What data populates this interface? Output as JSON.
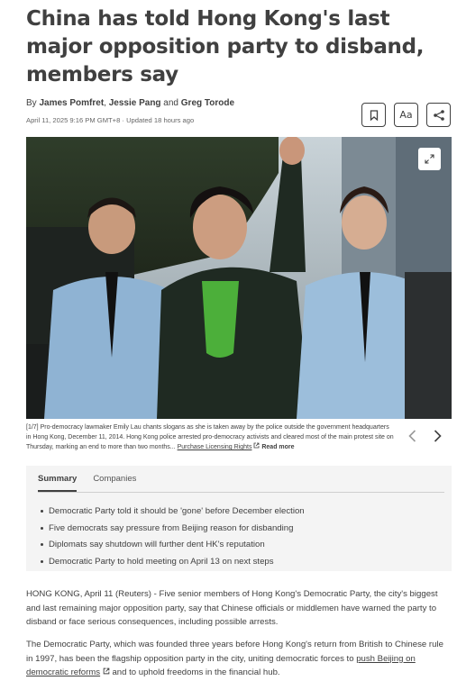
{
  "article": {
    "headline": "China has told Hong Kong's last major opposition party to disband, members say",
    "byline_prefix": "By ",
    "authors": [
      "James Pomfret",
      "Jessie Pang",
      "Greg Torode"
    ],
    "byline_sep1": ", ",
    "byline_sep2": " and ",
    "dateline": "April 11, 2025 9:16 PM GMT+8 · Updated 18 hours ago",
    "text_size_label": "Aa"
  },
  "photo": {
    "caption_counter": "[1/7]",
    "caption_text": " Pro-democracy lawmaker Emily Lau chants slogans as she is taken away by the police outside the government headquarters in Hong Kong, December 11, 2014. Hong Kong police arrested pro-democracy activists and cleared most of the main protest site on Thursday, marking an end to more than two months... ",
    "licensing_link": "Purchase Licensing Rights",
    "read_more": "Read more"
  },
  "summary": {
    "tabs": [
      "Summary",
      "Companies"
    ],
    "items": [
      "Democratic Party told it should be 'gone' before December election",
      "Five democrats say pressure from Beijing reason for disbanding",
      "Diplomats say shutdown will further dent HK's reputation",
      "Democratic Party to hold meeting on April 13 on next steps"
    ]
  },
  "body": {
    "para1": "HONG KONG, April 11 (Reuters) - Five senior members of Hong Kong's Democratic Party, the city's biggest and last remaining major opposition party, say that Chinese officials or middlemen have warned the party to disband or face serious consequences, including possible arrests.",
    "para2_a": "The Democratic Party, which was founded three years before Hong Kong's return from British to Chinese rule in 1997, has been the flagship opposition party in the city, uniting democratic forces to ",
    "para2_link": "push Beijing on democratic reforms",
    "para2_b": " and to uphold freedoms in the financial hub."
  },
  "colors": {
    "text": "#404040",
    "muted": "#666666",
    "panel": "#f4f4f4"
  },
  "icons": [
    "bookmark-icon",
    "share-icon",
    "expand-icon",
    "chevron-left-icon",
    "chevron-right-icon",
    "external-link-icon"
  ]
}
